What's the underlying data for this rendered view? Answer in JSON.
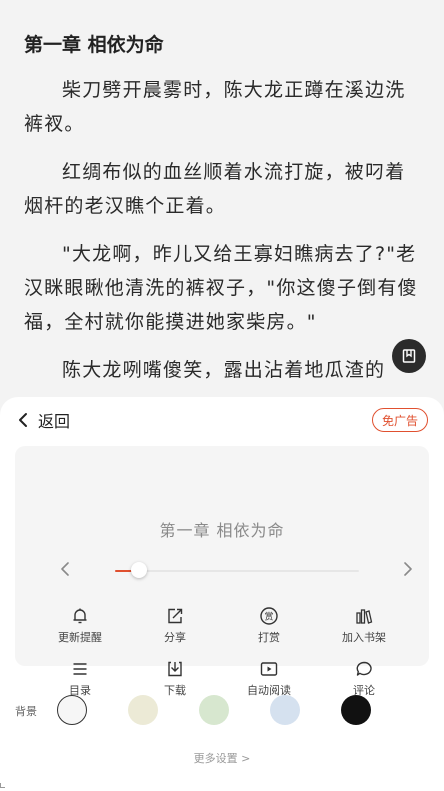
{
  "reader": {
    "chapter_title": "第一章 相依为命",
    "paragraphs": [
      "柴刀劈开晨雾时，陈大龙正蹲在溪边洗裤衩。",
      "红绸布似的血丝顺着水流打旋，被叼着烟杆的老汉瞧个正着。",
      "\"大龙啊，昨儿又给王寡妇瞧病去了?\"老汉眯眼瞅他清洗的裤衩子，\"你这傻子倒有傻福，全村就你能摸进她家柴房。\"",
      "陈大龙咧嘴傻笑，露出沾着地瓜渣的"
    ]
  },
  "menu": {
    "back_label": "返回",
    "no_ads_label": "免广告",
    "current_chapter": "第一章 相依为命",
    "progress_fraction": 0.1,
    "actions_row1": [
      {
        "label": "更新提醒",
        "icon": "bell-icon"
      },
      {
        "label": "分享",
        "icon": "share-icon"
      },
      {
        "label": "打赏",
        "icon": "reward-icon"
      },
      {
        "label": "加入书架",
        "icon": "bookshelf-icon"
      }
    ],
    "actions_row2": [
      {
        "label": "目录",
        "icon": "catalog-icon"
      },
      {
        "label": "下载",
        "icon": "download-icon"
      },
      {
        "label": "自动阅读",
        "icon": "auto-read-icon"
      },
      {
        "label": "评论",
        "icon": "comment-icon"
      }
    ],
    "background_label": "背景",
    "background_colors": [
      "#f6f6f6",
      "#ecead6",
      "#d7e7cf",
      "#d5e1ef",
      "#111111"
    ],
    "more_settings": "更多设置 >"
  },
  "colors": {
    "accent": "#e0502f",
    "page_bg": "#f3f3f3",
    "sheet_bg": "#ffffff"
  }
}
